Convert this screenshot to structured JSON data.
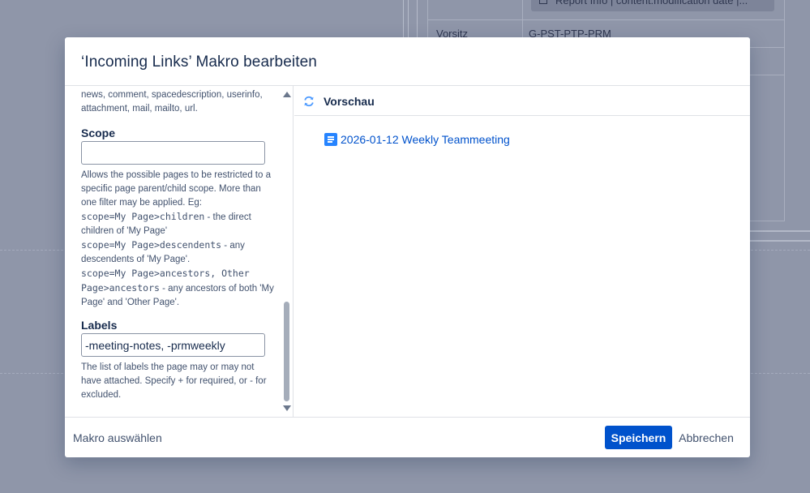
{
  "background": {
    "chip_text": "Report Info | content:modification date |...",
    "rows": [
      {
        "label": "Vorsitz",
        "value": "G-PST-PTP-PRM"
      }
    ]
  },
  "dialog": {
    "title": "‘Incoming Links’ Makro bearbeiten",
    "left": {
      "intro_text": "news, comment, spacedescription, userinfo, attachment, mail, mailto, url.",
      "scope": {
        "label": "Scope",
        "value": "",
        "help_intro": "Allows the possible pages to be restricted to a specific page parent/child scope. More than one filter may be applied. Eg:",
        "ex1_code": "scope=My Page>children",
        "ex1_text": " - the direct children of 'My Page'",
        "ex2_code": "scope=My Page>descendents",
        "ex2_text": " - any descendents of 'My Page'.",
        "ex3_code": "scope=My Page>ancestors, Other Page>ancestors",
        "ex3_text": " - any ancestors of both 'My Page' and 'Other Page'."
      },
      "labels": {
        "label": "Labels",
        "value": "-meeting-notes, -prmweekly",
        "help": "The list of labels the page may or may not have attached. Specify + for required, or - for excluded."
      }
    },
    "preview": {
      "title": "Vorschau",
      "items": [
        {
          "title": "2026-01-12 Weekly Teammeeting",
          "icon": "page-icon"
        }
      ]
    },
    "footer": {
      "select_macro": "Makro auswählen",
      "save": "Speichern",
      "cancel": "Abbrechen"
    }
  },
  "colors": {
    "primary": "#0052cc",
    "link": "#0052cc",
    "overlay": "#8f96a9"
  }
}
